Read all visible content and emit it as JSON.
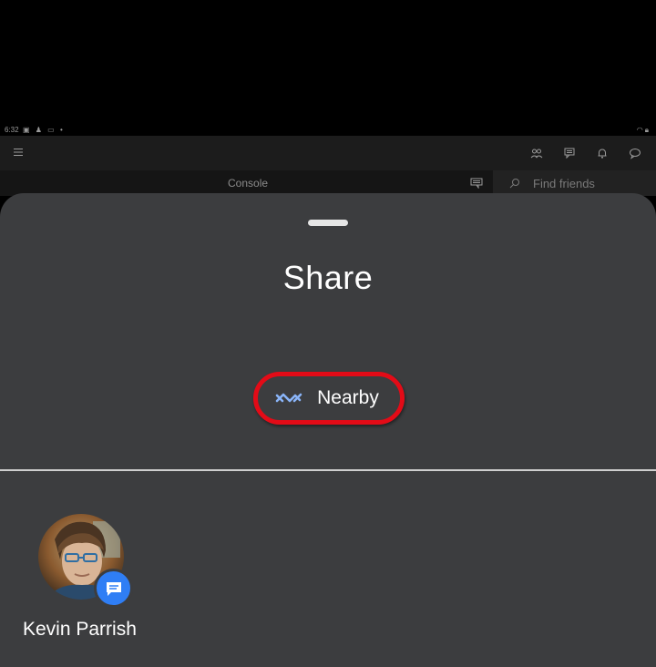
{
  "statusbar": {
    "time": "6:32",
    "left_icons": [
      "image-icon",
      "person-icon",
      "cast-icon",
      "dot"
    ],
    "right_icons": [
      "wifi-icon",
      "lock-icon"
    ]
  },
  "appbar": {
    "menu_icon": "hamburger-menu-icon",
    "right_icons": [
      "people-icon",
      "messages-icon",
      "bell-icon",
      "chat-bubble-icon"
    ]
  },
  "subbar": {
    "console_label": "Console",
    "friends_search_placeholder": "Find friends"
  },
  "share_sheet": {
    "title": "Share",
    "nearby_label": "Nearby",
    "nearby_icon": "nearby-share-icon",
    "highlight_color": "#e30b17",
    "accent_color": "#8ab4f8",
    "contacts": [
      {
        "name": "Kevin Parrish",
        "badge_icon": "messages-icon"
      }
    ]
  }
}
